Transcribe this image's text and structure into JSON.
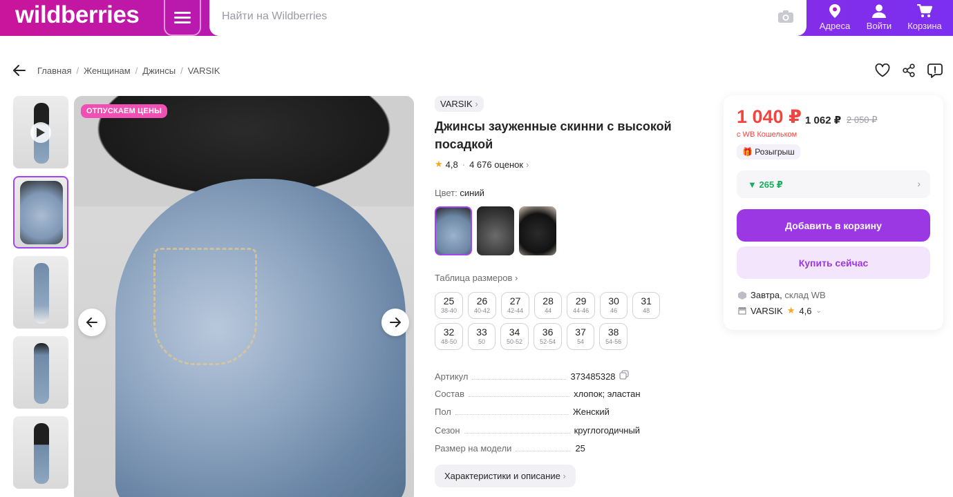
{
  "header": {
    "logo": "wildberries",
    "search_placeholder": "Найти на Wildberries",
    "nav": [
      {
        "label": "Адреса",
        "icon": "location-pin-icon"
      },
      {
        "label": "Войти",
        "icon": "user-icon"
      },
      {
        "label": "Корзина",
        "icon": "cart-icon"
      }
    ]
  },
  "breadcrumb": [
    "Главная",
    "Женщинам",
    "Джинсы",
    "VARSIK"
  ],
  "gallery": {
    "sale_badge": "ОТПУСКАЕМ ЦЕНЫ",
    "thumbnail_count": 5,
    "active_thumbnail": 2
  },
  "product": {
    "brand": "VARSIK",
    "title": "Джинсы зауженные скинни с высокой посадкой",
    "rating": "4,8",
    "reviews": "4 676 оценок",
    "color_label": "Цвет:",
    "color_value": "синий",
    "size_table_link": "Таблица размеров",
    "sizes_row1": [
      {
        "n": "25",
        "r": "38-40"
      },
      {
        "n": "26",
        "r": "40-42"
      },
      {
        "n": "27",
        "r": "42-44"
      },
      {
        "n": "28",
        "r": "44"
      },
      {
        "n": "29",
        "r": "44-46"
      },
      {
        "n": "30",
        "r": "46"
      },
      {
        "n": "31",
        "r": "48"
      }
    ],
    "sizes_row2": [
      {
        "n": "32",
        "r": "48-50"
      },
      {
        "n": "33",
        "r": "50"
      },
      {
        "n": "34",
        "r": "50-52"
      },
      {
        "n": "36",
        "r": "52-54"
      },
      {
        "n": "37",
        "r": "54"
      },
      {
        "n": "38",
        "r": "54-56"
      }
    ],
    "specs": [
      {
        "k": "Артикул",
        "v": "373485328"
      },
      {
        "k": "Состав",
        "v": "хлопок; эластан"
      },
      {
        "k": "Пол",
        "v": "Женский"
      },
      {
        "k": "Сезон",
        "v": "круглогодичный"
      },
      {
        "k": "Размер на модели",
        "v": "25"
      }
    ],
    "characteristics_button": "Характеристики и описание"
  },
  "price_card": {
    "price": "1 040 ₽",
    "price_mid": "1 062 ₽",
    "price_old": "2 050 ₽",
    "price_note": "с WB Кошельком",
    "raffle": "Розыгрыш",
    "cashback": "▼ 265 ₽",
    "add_to_cart": "Добавить в корзину",
    "buy_now": "Купить сейчас",
    "delivery_day": "Завтра,",
    "delivery_warehouse": "склад WB",
    "seller": "VARSIK",
    "seller_rating": "4,6"
  },
  "colors": {
    "accent": "#9b37e3",
    "price_red": "#f0463f",
    "cashback_green": "#14b05a"
  }
}
